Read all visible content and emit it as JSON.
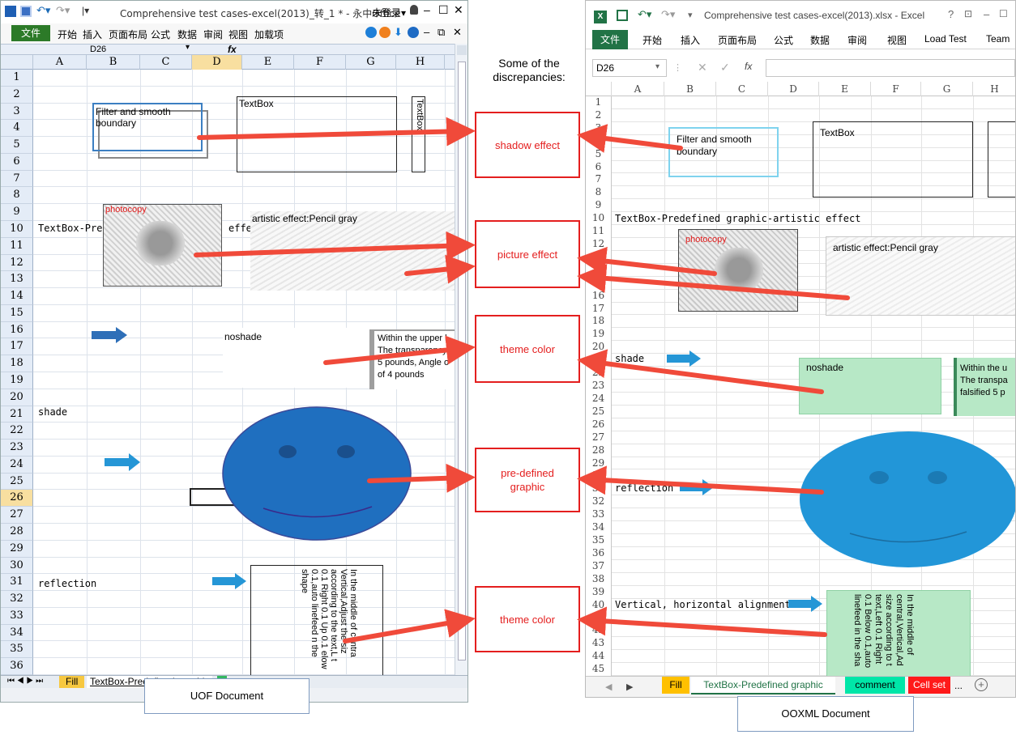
{
  "left": {
    "title": "Comprehensive test cases-excel(2013)_转_1 * - 永中Office",
    "login": "未登录▾",
    "menu": [
      "文件",
      "开始",
      "插入",
      "页面布局",
      "公式",
      "数据",
      "审阅",
      "视图",
      "加载项"
    ],
    "cell_ref": "D26",
    "fx": "fx",
    "columns": [
      "A",
      "B",
      "C",
      "D",
      "E",
      "F",
      "G",
      "H"
    ],
    "rows": [
      "1",
      "2",
      "3",
      "4",
      "5",
      "6",
      "7",
      "8",
      "9",
      "10",
      "11",
      "12",
      "13",
      "14",
      "15",
      "16",
      "17",
      "18",
      "19",
      "20",
      "21",
      "22",
      "23",
      "24",
      "25",
      "26",
      "27",
      "28",
      "29",
      "30",
      "31",
      "32",
      "33",
      "34",
      "35",
      "36"
    ],
    "cells": {
      "r10": "TextBox-Pred",
      "effect_frag": "effec",
      "r21": "shade",
      "r31": "reflection"
    },
    "shapes": {
      "filter_text": "Filter and smooth boundary",
      "textbox": "TextBox",
      "textbox_vertical": "TextBox",
      "photocopy": "photocopy",
      "artistic": "artistic effect:Pencil gray",
      "noshade": "noshade",
      "within_upper": "Within the upper l",
      "transparency": "The transparency",
      "pounds": "5 pounds, Angle o",
      "of_pounds": "of 4 pounds",
      "vertical_text": "In the middle of centra Vertical,Adjust the siz according to the text,L t 0.1 Right 0.1 Up 0.1 elow 0.1,auto linefeed n the shape"
    },
    "tabs": [
      "Fill",
      "TextBox-Predefined graphic",
      "c"
    ],
    "doc_label": "UOF Document"
  },
  "right": {
    "title": "Comprehensive test cases-excel(2013).xlsx - Excel",
    "ribbon": [
      "文件",
      "开始",
      "插入",
      "页面布局",
      "公式",
      "数据",
      "审阅",
      "视图",
      "Load Test",
      "Team"
    ],
    "cell_ref": "D26",
    "fx": "fx",
    "columns": [
      "A",
      "B",
      "C",
      "D",
      "E",
      "F",
      "G",
      "H"
    ],
    "rows": [
      "1",
      "2",
      "3",
      "4",
      "5",
      "6",
      "7",
      "8",
      "9",
      "10",
      "11",
      "12",
      "13",
      "14",
      "15",
      "16",
      "17",
      "18",
      "19",
      "20",
      "21",
      "22",
      "23",
      "24",
      "25",
      "26",
      "27",
      "28",
      "29",
      "30",
      "31",
      "32",
      "33",
      "34",
      "35",
      "36",
      "37",
      "38",
      "39",
      "40",
      "41",
      "42",
      "43",
      "44",
      "45"
    ],
    "cells": {
      "r10": "TextBox-Predefined graphic-artistic effect",
      "r21": "shade",
      "r31": "reflection",
      "r40": "Vertical, horizontal alignment"
    },
    "shapes": {
      "filter_text": "Filter and smooth boundary",
      "textbox": "TextBox",
      "photocopy": "photocopy",
      "artistic": "artistic effect:Pencil gray",
      "noshade": "noshade",
      "within": "Within the u",
      "transparency": "The transpa",
      "falsified": "falsified 5 p",
      "vertical_text": "In the middle of central,Vertical,Ad size according to t text,Left 0.1 Right 0.1 Below 0.1,auto linefeed in the sha"
    },
    "tabs": [
      "Fill",
      "TextBox-Predefined graphic",
      "comment",
      "Cell set",
      "..."
    ],
    "doc_label": "OOXML Document"
  },
  "center": {
    "heading": "Some of the discrepancies:",
    "callouts": [
      "shadow effect",
      "picture effect",
      "theme color",
      "pre-defined graphic",
      "theme color"
    ]
  },
  "colors": {
    "accent_red": "#e41e1e",
    "excel_green": "#217346",
    "smiley_blue_left": "#1f6fbf",
    "smiley_blue_right": "#2296d8",
    "theme_green": "#b7e8c6"
  }
}
